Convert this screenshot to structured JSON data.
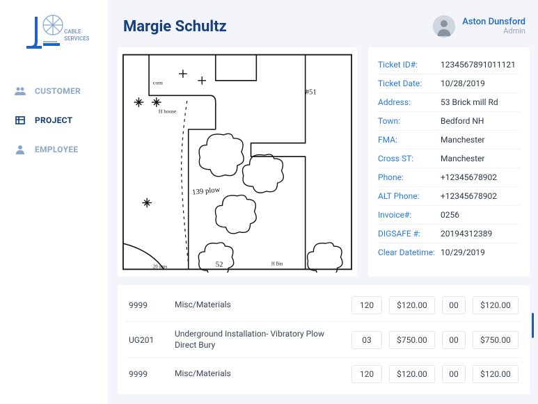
{
  "brand": {
    "name": "CABLE SERVICES"
  },
  "nav": {
    "customer": "CUSTOMER",
    "project": "PROJECT",
    "employee": "EMPLOYEE"
  },
  "header": {
    "title": "Margie Schultz",
    "user_name": "Aston Dunsford",
    "user_role": "Admin"
  },
  "ticket": {
    "id_label": "Ticket ID#:",
    "id": "1234567891011121",
    "date_label": "Ticket Date:",
    "date": "10/28/2019",
    "address_label": "Address:",
    "address": "53 Brick mill Rd",
    "town_label": "Town:",
    "town": "Bedford NH",
    "fma_label": "FMA:",
    "fma": "Manchester",
    "cross_label": "Cross ST:",
    "cross": "Manchester",
    "phone_label": "Phone:",
    "phone": "+12345678902",
    "alt_label": "ALT Phone:",
    "alt": "+12345678902",
    "inv_label": "Invoice#:",
    "inv": "0256",
    "dig_label": "DIGSAFE #:",
    "dig": "20194312389",
    "clear_label": "Clear Datetime:",
    "clear": "10/29/2019"
  },
  "rows": [
    {
      "code": "9999",
      "desc": "Misc/Materials",
      "qty": "120",
      "price": "$120.00",
      "ext": "00",
      "total": "$120.00"
    },
    {
      "code": "UG201",
      "desc": "Underground Installation- Vibratory Plow Direct Bury",
      "qty": "03",
      "price": "$750.00",
      "ext": "00",
      "total": "$750.00"
    },
    {
      "code": "9999",
      "desc": "Misc/Materials",
      "qty": "120",
      "price": "$120.00",
      "ext": "00",
      "total": "$120.00"
    }
  ]
}
